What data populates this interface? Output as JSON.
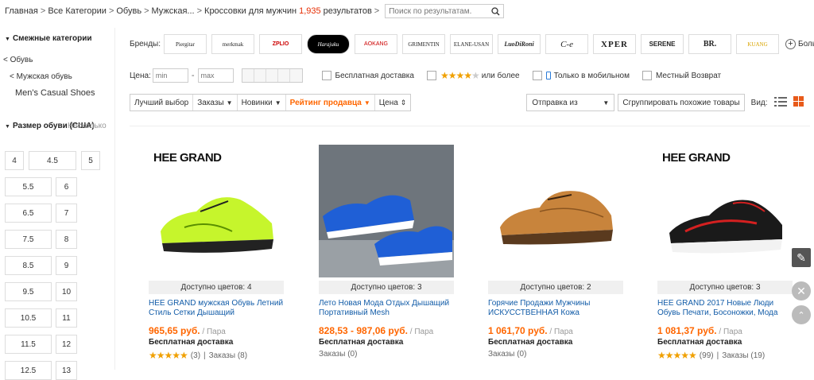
{
  "breadcrumb": {
    "items": [
      "Главная",
      "Все Категории",
      "Обувь",
      "Мужская..."
    ],
    "current": "Кроссовки для мужчин",
    "count": "1,935",
    "count_suffix": "результатов"
  },
  "search": {
    "placeholder": "Поиск по результатам."
  },
  "sidebar": {
    "related_title": "Смежные категории",
    "cats": [
      "< Обувь",
      "< Мужская обувь",
      "Men's Casual Shoes"
    ],
    "size_title": "Размер обуви (США)",
    "size_multi": "Несколько",
    "sizes": [
      "4",
      "4.5",
      "5",
      "5.5",
      "6",
      "6.5",
      "7",
      "7.5",
      "8",
      "8.5",
      "9",
      "9.5",
      "10",
      "10.5",
      "11",
      "11.5",
      "12",
      "12.5",
      "13"
    ]
  },
  "filters": {
    "brands_label": "Бренды:",
    "brands": [
      "Piergitar",
      "merkmak",
      "ZPLIO",
      "Harajuku",
      "AOKANG",
      "GRIMENTIN",
      "ELANE-USAN",
      "LuoDiRoni",
      "C-e",
      "XPER",
      "SERENE",
      "BR.",
      "KUANG"
    ],
    "more": "Больше",
    "price_label": "Цена:",
    "price_min_placeholder": "min",
    "price_max_placeholder": "max",
    "free_shipping": "Бесплатная доставка",
    "rating_or_more": "или более",
    "mobile_only": "Только в мобильном",
    "local_return": "Местный Возврат"
  },
  "sort": {
    "best": "Лучший выбор",
    "orders": "Заказы",
    "new": "Новинки",
    "seller_rating": "Рейтинг продавца",
    "price": "Цена",
    "ship_from": "Отправка из",
    "group_similar": "Сгруппировать похожие товары",
    "view_label": "Вид:"
  },
  "products": [
    {
      "brand_overlay": "HEE GRAND",
      "colors": "Доступно цветов: 4",
      "title": "HEE GRAND мужская Обувь Летний Стиль Сетки Дышащий",
      "price": "965,65 руб.",
      "unit": "/ Пара",
      "shipping": "Бесплатная доставка",
      "rating_count": "(3)",
      "orders": "Заказы (8)",
      "stars": 5
    },
    {
      "brand_overlay": "",
      "colors": "Доступно цветов: 3",
      "title": "Лето Новая Мода Отдых Дышащий Портативный Mesh",
      "price": "828,53 - 987,06 руб.",
      "unit": "/ Пара",
      "shipping": "Бесплатная доставка",
      "rating_count": "",
      "orders": "Заказы (0)",
      "stars": 0
    },
    {
      "brand_overlay": "",
      "colors": "Доступно цветов: 2",
      "title": "Горячие Продажи Мужчины ИСКУССТВЕННАЯ Кожа",
      "price": "1 061,70 руб.",
      "unit": "/ Пара",
      "shipping": "Бесплатная доставка",
      "rating_count": "",
      "orders": "Заказы (0)",
      "stars": 0
    },
    {
      "brand_overlay": "HEE GRAND",
      "colors": "Доступно цветов: 3",
      "title": "HEE GRAND 2017 Новые Люди Обувь Печати, Босоножки, Мода",
      "price": "1 081,37 руб.",
      "unit": "/ Пара",
      "shipping": "Бесплатная доставка",
      "rating_count": "(99)",
      "orders": "Заказы (19)",
      "stars": 5
    }
  ],
  "colors": {
    "accent": "#ff6600",
    "link": "#125ca8",
    "star": "#f0a000",
    "count": "#e62e04"
  }
}
